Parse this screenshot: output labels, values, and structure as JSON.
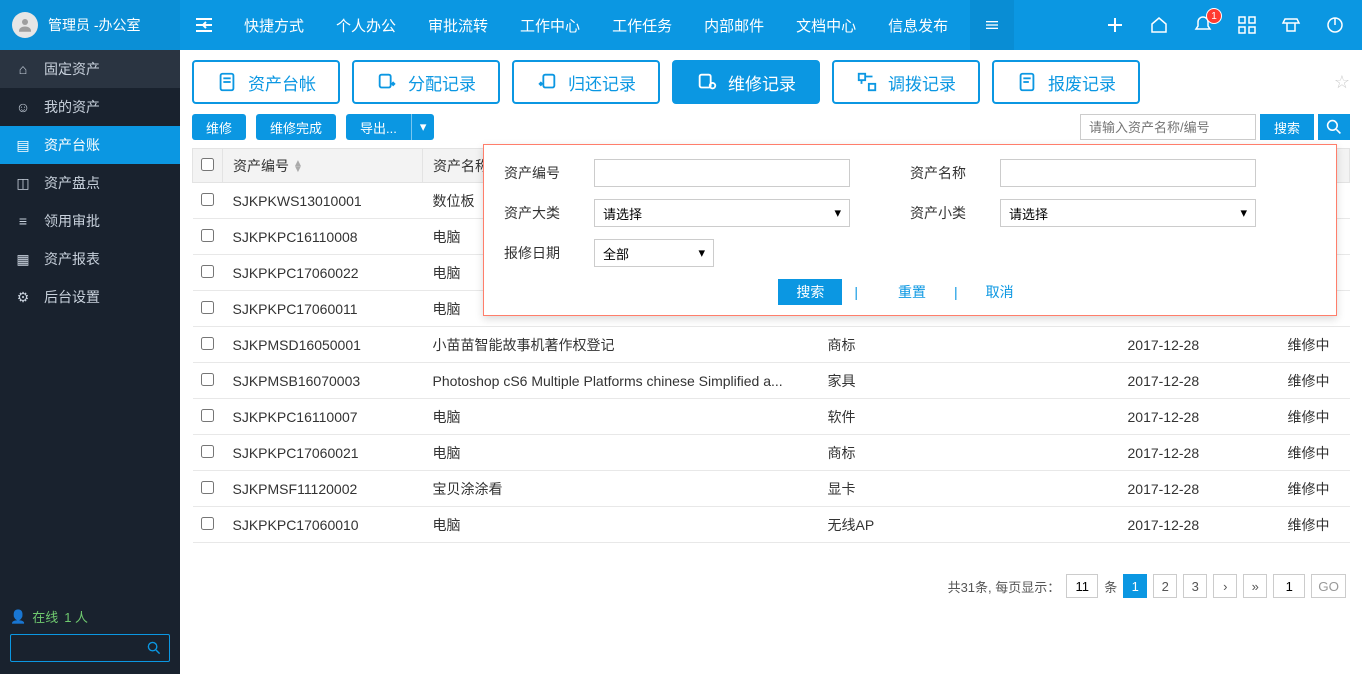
{
  "header": {
    "user_title": "管理员 -办公室",
    "nav": [
      "快捷方式",
      "个人办公",
      "审批流转",
      "工作中心",
      "工作任务",
      "内部邮件",
      "文档中心",
      "信息发布"
    ],
    "badge": "1"
  },
  "sidebar": {
    "items": [
      {
        "label": "固定资产",
        "icon": "home"
      },
      {
        "label": "我的资产",
        "icon": "user"
      },
      {
        "label": "资产台账",
        "icon": "ledger",
        "active": true
      },
      {
        "label": "资产盘点",
        "icon": "inventory"
      },
      {
        "label": "领用审批",
        "icon": "approval"
      },
      {
        "label": "资产报表",
        "icon": "report"
      },
      {
        "label": "后台设置",
        "icon": "settings"
      }
    ],
    "online_label": "在线",
    "online_count": "1 人"
  },
  "tabs": [
    {
      "label": "资产台帐"
    },
    {
      "label": "分配记录"
    },
    {
      "label": "归还记录"
    },
    {
      "label": "维修记录",
      "active": true
    },
    {
      "label": "调拨记录"
    },
    {
      "label": "报废记录"
    }
  ],
  "actions": {
    "repair": "维修",
    "repair_done": "维修完成",
    "export": "导出...",
    "search_placeholder": "请输入资产名称/编号",
    "search_btn": "搜索"
  },
  "adv": {
    "f_code": "资产编号",
    "f_name": "资产名称",
    "f_cat1": "资产大类",
    "f_cat2": "资产小类",
    "f_date": "报修日期",
    "opt_please": "请选择",
    "opt_all": "全部",
    "btn_search": "搜索",
    "btn_reset": "重置",
    "btn_cancel": "取消"
  },
  "columns": {
    "code": "资产编号",
    "name": "资产名称"
  },
  "rows": [
    {
      "code": "SJKPKWS13010001",
      "name": "数位板",
      "cat": "",
      "date": "",
      "status": ""
    },
    {
      "code": "SJKPKPC16110008",
      "name": "电脑",
      "cat": "",
      "date": "",
      "status": ""
    },
    {
      "code": "SJKPKPC17060022",
      "name": "电脑",
      "cat": "",
      "date": "",
      "status": ""
    },
    {
      "code": "SJKPKPC17060011",
      "name": "电脑",
      "cat": "",
      "date": "",
      "status": ""
    },
    {
      "code": "SJKPMSD16050001",
      "name": "小苗苗智能故事机著作权登记",
      "cat": "商标",
      "date": "2017-12-28",
      "status": "维修中"
    },
    {
      "code": "SJKPMSB16070003",
      "name": "Photoshop cS6 Multiple Platforms chinese Simplified a...",
      "cat": "家具",
      "date": "2017-12-28",
      "status": "维修中"
    },
    {
      "code": "SJKPKPC16110007",
      "name": "电脑",
      "cat": "软件",
      "date": "2017-12-28",
      "status": "维修中"
    },
    {
      "code": "SJKPKPC17060021",
      "name": "电脑",
      "cat": "商标",
      "date": "2017-12-28",
      "status": "维修中"
    },
    {
      "code": "SJKPMSF11120002",
      "name": "宝贝涂涂看",
      "cat": "显卡",
      "date": "2017-12-28",
      "status": "维修中"
    },
    {
      "code": "SJKPKPC17060010",
      "name": "电脑",
      "cat": "无线AP",
      "date": "2017-12-28",
      "status": "维修中"
    }
  ],
  "pager": {
    "total_text": "共31条, 每页显示：",
    "per_page": "11",
    "unit": "条",
    "pages": [
      "1",
      "2",
      "3"
    ],
    "next": "›",
    "last": "»",
    "goto": "1",
    "go": "GO"
  }
}
